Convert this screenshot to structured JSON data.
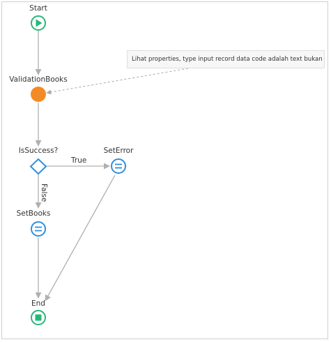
{
  "nodes": {
    "start": {
      "label": "Start",
      "icon": "play-icon"
    },
    "validation": {
      "label": "ValidationBooks",
      "icon": "server-action-icon"
    },
    "is_success": {
      "label": "IsSuccess?",
      "icon": "decision-diamond-icon"
    },
    "set_error": {
      "label": "SetError",
      "icon": "assign-icon"
    },
    "set_books": {
      "label": "SetBooks",
      "icon": "assign-icon"
    },
    "end": {
      "label": "End",
      "icon": "stop-icon"
    }
  },
  "edges": {
    "true_label": "True",
    "false_label": "False"
  },
  "comment": {
    "text": "Lihat properties, type input record data code adalah text bukan integer"
  },
  "colors": {
    "start_end": "#29b67a",
    "action": "#f28b26",
    "decision": "#2f8fde",
    "assign": "#2f8fde",
    "connector": "#b0b0b0",
    "comment_link": "#a9a9a9"
  }
}
